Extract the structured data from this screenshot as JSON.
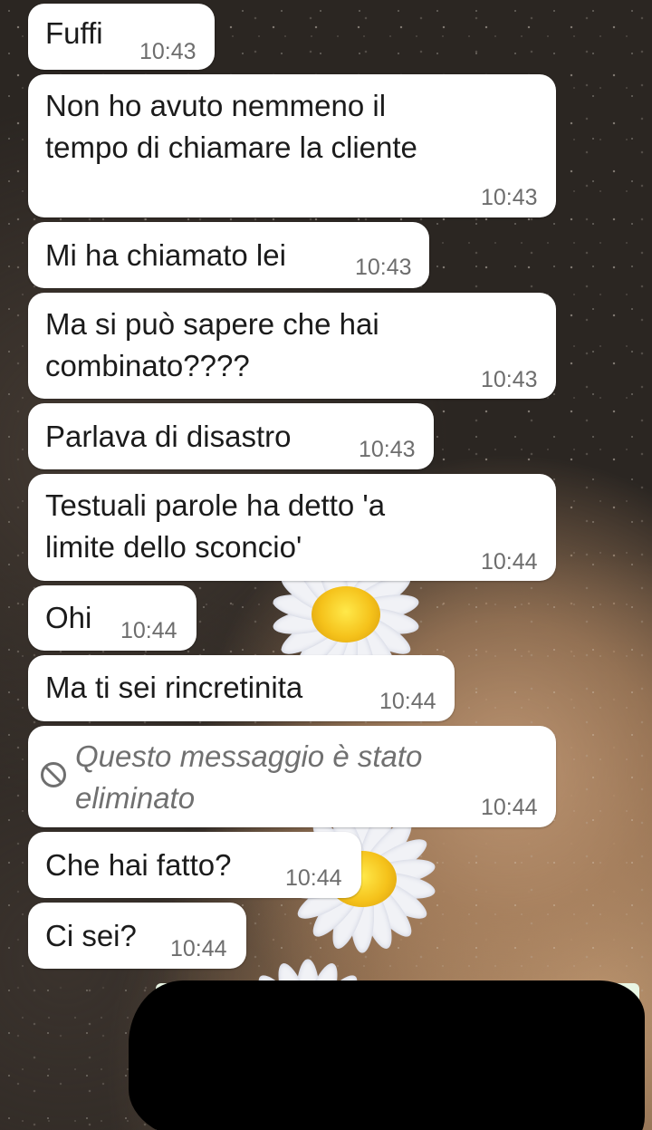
{
  "messages": [
    {
      "text": "Fuffi",
      "time": "10:43",
      "deleted": false
    },
    {
      "text": "Non ho avuto nemmeno il\ntempo di chiamare la cliente",
      "time": "10:43",
      "deleted": false
    },
    {
      "text": "Mi ha chiamato lei",
      "time": "10:43",
      "deleted": false
    },
    {
      "text": "Ma si può sapere che hai\ncombinato????",
      "time": "10:43",
      "deleted": false
    },
    {
      "text": "Parlava di disastro",
      "time": "10:43",
      "deleted": false
    },
    {
      "text": "Testuali parole ha detto 'a\nlimite dello sconcio'",
      "time": "10:44",
      "deleted": false
    },
    {
      "text": "Ohi",
      "time": "10:44",
      "deleted": false
    },
    {
      "text": "Ma ti sei rincretinita",
      "time": "10:44",
      "deleted": false
    },
    {
      "text": "Questo messaggio è stato\neliminato",
      "time": "10:44",
      "deleted": true
    },
    {
      "text": "Che hai fatto?",
      "time": "10:44",
      "deleted": false
    },
    {
      "text": "Ci sei?",
      "time": "10:44",
      "deleted": false
    }
  ],
  "icons": {
    "deleted_message": "blocked-icon"
  },
  "colors": {
    "bubble": "#ffffff",
    "time": "#6d6d6d",
    "deleted_text": "#707070"
  }
}
